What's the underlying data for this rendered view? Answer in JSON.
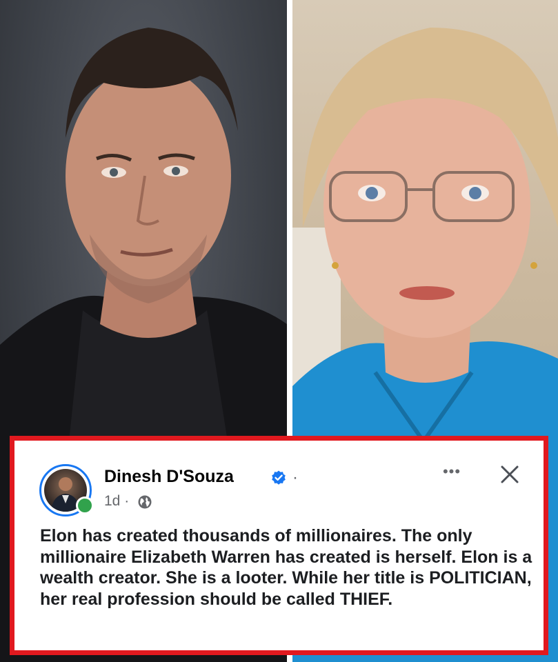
{
  "photos": {
    "left": {
      "icon": "person-portrait-man-dark-shirt"
    },
    "right": {
      "icon": "person-portrait-woman-blue-top"
    }
  },
  "post": {
    "author": "Dinesh D'Souza",
    "separator": "·",
    "time": "1d ·",
    "visibility_icon": "globe-icon",
    "more_label": "•••",
    "close_icon": "close-icon",
    "text": "Elon has created thousands of millionaires. The only millionaire Elizabeth Warren has created is herself. Elon is a wealth creator. She is a looter. While her title is POLITICIAN, her real profession should be called THIEF."
  },
  "colors": {
    "frame_border": "#e1191f",
    "verified_blue": "#1877f2",
    "online_green": "#31a24c",
    "text_primary": "#1c1e21",
    "text_secondary": "#65676b"
  }
}
